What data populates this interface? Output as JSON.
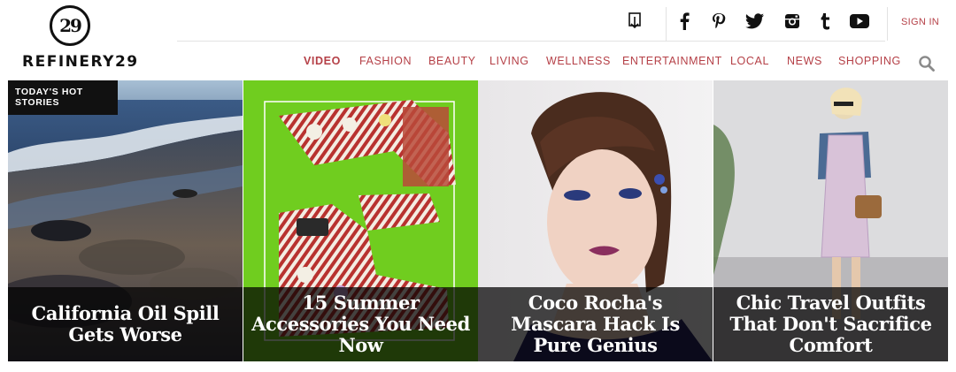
{
  "brand": {
    "logo_mark": "29",
    "name": "REFINERY29"
  },
  "header": {
    "icons": [
      "app-download-icon",
      "facebook-icon",
      "pinterest-icon",
      "twitter-icon",
      "instagram-icon",
      "tumblr-icon",
      "youtube-icon"
    ],
    "sign_in": "SIGN IN"
  },
  "nav": {
    "items": [
      {
        "label": "VIDEO"
      },
      {
        "label": "FASHION"
      },
      {
        "label": "BEAUTY"
      },
      {
        "label": "LIVING"
      },
      {
        "label": "WELLNESS"
      },
      {
        "label": "ENTERTAINMENT"
      },
      {
        "label": "LOCAL"
      },
      {
        "label": "NEWS"
      },
      {
        "label": "SHOPPING"
      }
    ],
    "active": "VIDEO",
    "search_icon": "search-icon"
  },
  "stories": {
    "section_label": "TODAY'S HOT STORIES",
    "items": [
      {
        "headline": "California Oil Spill Gets Worse"
      },
      {
        "headline": "15 Summer Accessories You Need Now"
      },
      {
        "headline": "Coco Rocha's Mascara Hack Is Pure Genius"
      },
      {
        "headline": "Chic Travel Outfits That Don't Sacrifice Comfort"
      }
    ]
  },
  "colors": {
    "accent": "#b54047",
    "text_dark": "#111111",
    "green": "#6ccd1f"
  }
}
